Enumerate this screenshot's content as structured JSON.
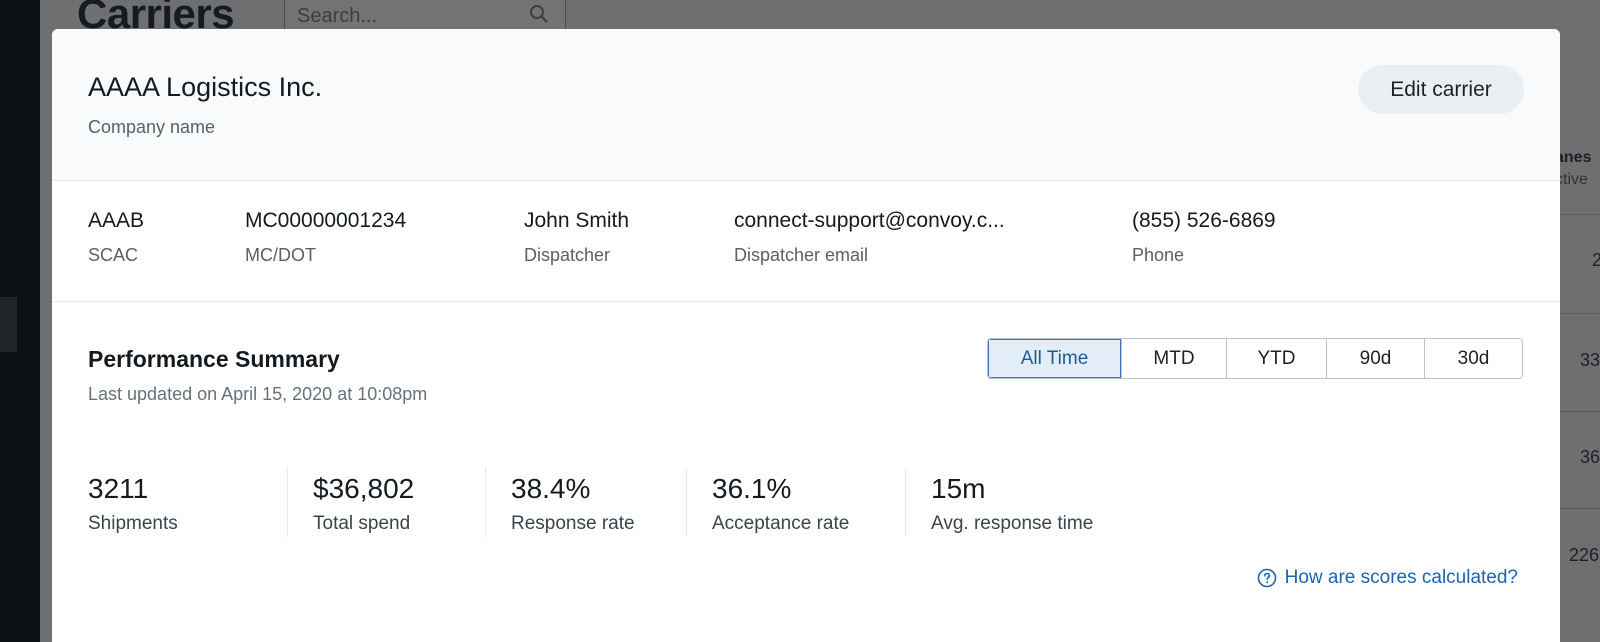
{
  "background": {
    "page_title": "Carriers",
    "search_placeholder": "Search...",
    "column_header": "anes",
    "column_subheader": "ctive",
    "cells": [
      "2",
      "33",
      "36",
      "226"
    ]
  },
  "modal": {
    "company_name": "AAAA Logistics Inc.",
    "company_label": "Company name",
    "edit_label": "Edit carrier",
    "info": [
      {
        "value": "AAAB",
        "label": "SCAC"
      },
      {
        "value": "MC00000001234",
        "label": "MC/DOT"
      },
      {
        "value": "John Smith",
        "label": "Dispatcher"
      },
      {
        "value": "connect-support@convoy.c...",
        "label": "Dispatcher email"
      },
      {
        "value": "(855) 526-6869",
        "label": "Phone"
      }
    ],
    "performance": {
      "title": "Performance Summary",
      "updated": "Last updated on April 15, 2020 at 10:08pm",
      "ranges": [
        "All Time",
        "MTD",
        "YTD",
        "90d",
        "30d"
      ],
      "active_range": "All Time",
      "stats": [
        {
          "value": "3211",
          "label": "Shipments"
        },
        {
          "value": "$36,802",
          "label": "Total spend"
        },
        {
          "value": "38.4%",
          "label": "Response rate"
        },
        {
          "value": "36.1%",
          "label": "Acceptance rate"
        },
        {
          "value": "15m",
          "label": "Avg. response time"
        }
      ],
      "help_link": "How are scores calculated?"
    }
  },
  "colors": {
    "accent": "#1c64b0",
    "active_range_bg": "#e3edf7",
    "overlay": "#6e6f70"
  }
}
